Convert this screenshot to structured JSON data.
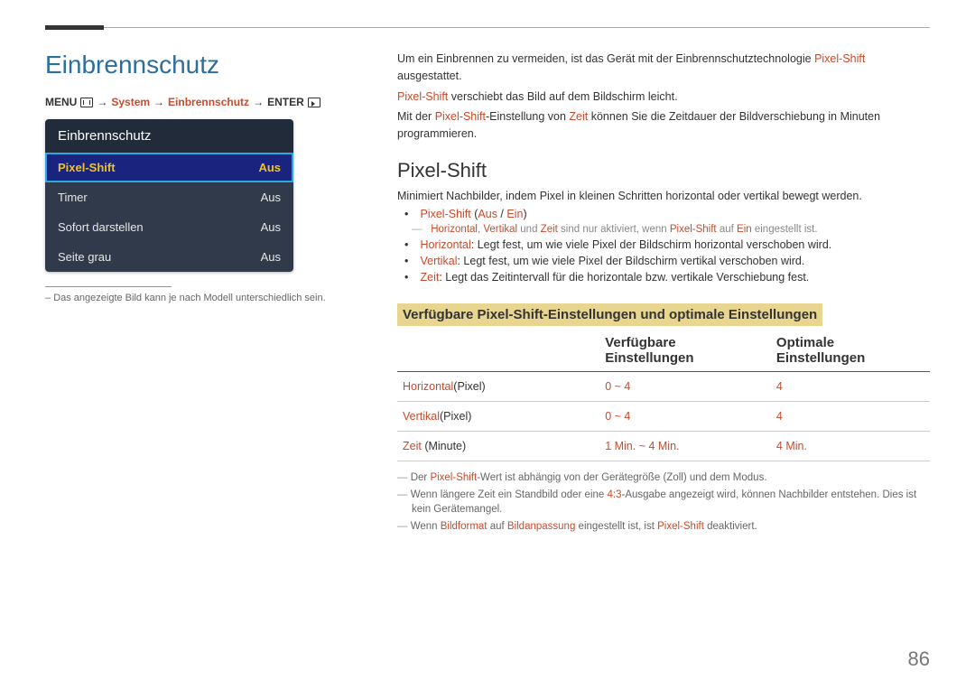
{
  "page_number": "86",
  "title": "Einbrennschutz",
  "breadcrumb": {
    "prefix": "MENU",
    "system": "System",
    "mid": "Einbrennschutz",
    "suffix": "ENTER"
  },
  "osd": {
    "title": "Einbrennschutz",
    "rows": [
      {
        "label": "Pixel-Shift",
        "value": "Aus",
        "selected": true
      },
      {
        "label": "Timer",
        "value": "Aus",
        "selected": false
      },
      {
        "label": "Sofort darstellen",
        "value": "Aus",
        "selected": false
      },
      {
        "label": "Seite grau",
        "value": "Aus",
        "selected": false
      }
    ]
  },
  "left_note": "Das angezeigte Bild kann je nach Modell unterschiedlich sein.",
  "intro": {
    "l1a": "Um ein Einbrennen zu vermeiden, ist das Gerät mit der Einbrennschutztechnologie ",
    "l1b": "Pixel-Shift",
    "l1c": " ausgestattet.",
    "l2a": "Pixel-Shift",
    "l2b": " verschiebt das Bild auf dem Bildschirm leicht.",
    "l3a": "Mit der ",
    "l3b": "Pixel-Shift",
    "l3c": "-Einstellung von ",
    "l3d": "Zeit",
    "l3e": " können Sie die Zeitdauer der Bildverschiebung in Minuten programmieren."
  },
  "section_title": "Pixel-Shift",
  "section_desc": "Minimiert Nachbilder, indem Pixel in kleinen Schritten horizontal oder vertikal bewegt werden.",
  "b1": {
    "p": "Pixel-Shift",
    "open": " (",
    "a": "Aus",
    "slash": " / ",
    "b": "Ein",
    "close": ")"
  },
  "sub1": {
    "a": "Horizontal",
    "c1": ", ",
    "b": "Vertikal",
    "c2": " und ",
    "c": "Zeit",
    "t1": " sind nur aktiviert, wenn ",
    "d": "Pixel-Shift",
    "t2": " auf ",
    "e": "Ein",
    "t3": " eingestellt ist."
  },
  "inner": [
    {
      "name": "Horizontal",
      "text": ": Legt fest, um wie viele Pixel der Bildschirm horizontal verschoben wird."
    },
    {
      "name": "Vertikal",
      "text": ": Legt fest, um wie viele Pixel der Bildschirm vertikal verschoben wird."
    },
    {
      "name": "Zeit",
      "text": ": Legt das Zeitintervall für die horizontale bzw. vertikale Verschiebung fest."
    }
  ],
  "banner": "Verfügbare Pixel-Shift-Einstellungen und optimale Einstellungen",
  "table": {
    "h1": "",
    "h2": "Verfügbare Einstellungen",
    "h3": "Optimale Einstellungen",
    "rows": [
      {
        "name": "Horizontal",
        "unit": "(Pixel)",
        "range": "0 ~ 4",
        "opt": "4"
      },
      {
        "name": "Vertikal",
        "unit": "(Pixel)",
        "range": "0 ~ 4",
        "opt": "4"
      },
      {
        "name": "Zeit",
        "unit": " (Minute)",
        "range": "1 Min. ~ 4 Min.",
        "opt": "4 Min."
      }
    ]
  },
  "notes": {
    "n1a": "Der ",
    "n1b": "Pixel-Shift",
    "n1c": "-Wert ist abhängig von der Gerätegröße (Zoll) und dem Modus.",
    "n2a": "Wenn längere Zeit ein Standbild oder eine ",
    "n2b": "4:3",
    "n2c": "-Ausgabe angezeigt wird, können Nachbilder entstehen. Dies ist kein Gerätemangel.",
    "n3a": "Wenn ",
    "n3b": "Bildformat",
    "n3c": " auf ",
    "n3d": "Bildanpassung",
    "n3e": " eingestellt ist, ist ",
    "n3f": "Pixel-Shift",
    "n3g": " deaktiviert."
  }
}
